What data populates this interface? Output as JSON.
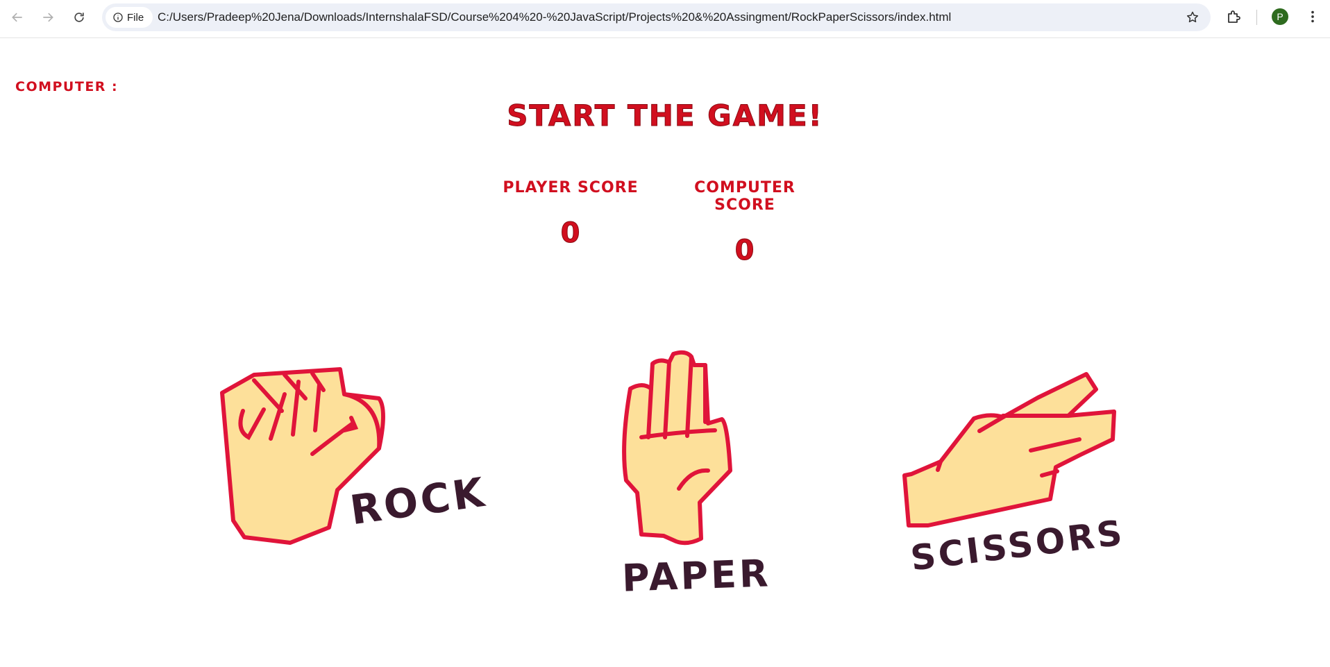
{
  "browser": {
    "file_chip_label": "File",
    "url": "C:/Users/Pradeep%20Jena/Downloads/InternshalaFSD/Course%204%20-%20JavaScript/Projects%20&%20Assingment/RockPaperScissors/index.html",
    "avatar_letter": "P"
  },
  "game": {
    "computer_label": "Computer :",
    "title": "Start the game!",
    "player_score_label": "Player Score",
    "computer_score_label": "Computer Score",
    "player_score": "0",
    "computer_score": "0"
  },
  "choices": {
    "rock": "ROCK",
    "paper": "PAPER",
    "scissors": "SCISSORS"
  },
  "colors": {
    "accent_red": "#d10f1f",
    "hand_fill": "#fde09a",
    "hand_outline": "#e0143a",
    "label_dark": "#3a1a2e"
  }
}
